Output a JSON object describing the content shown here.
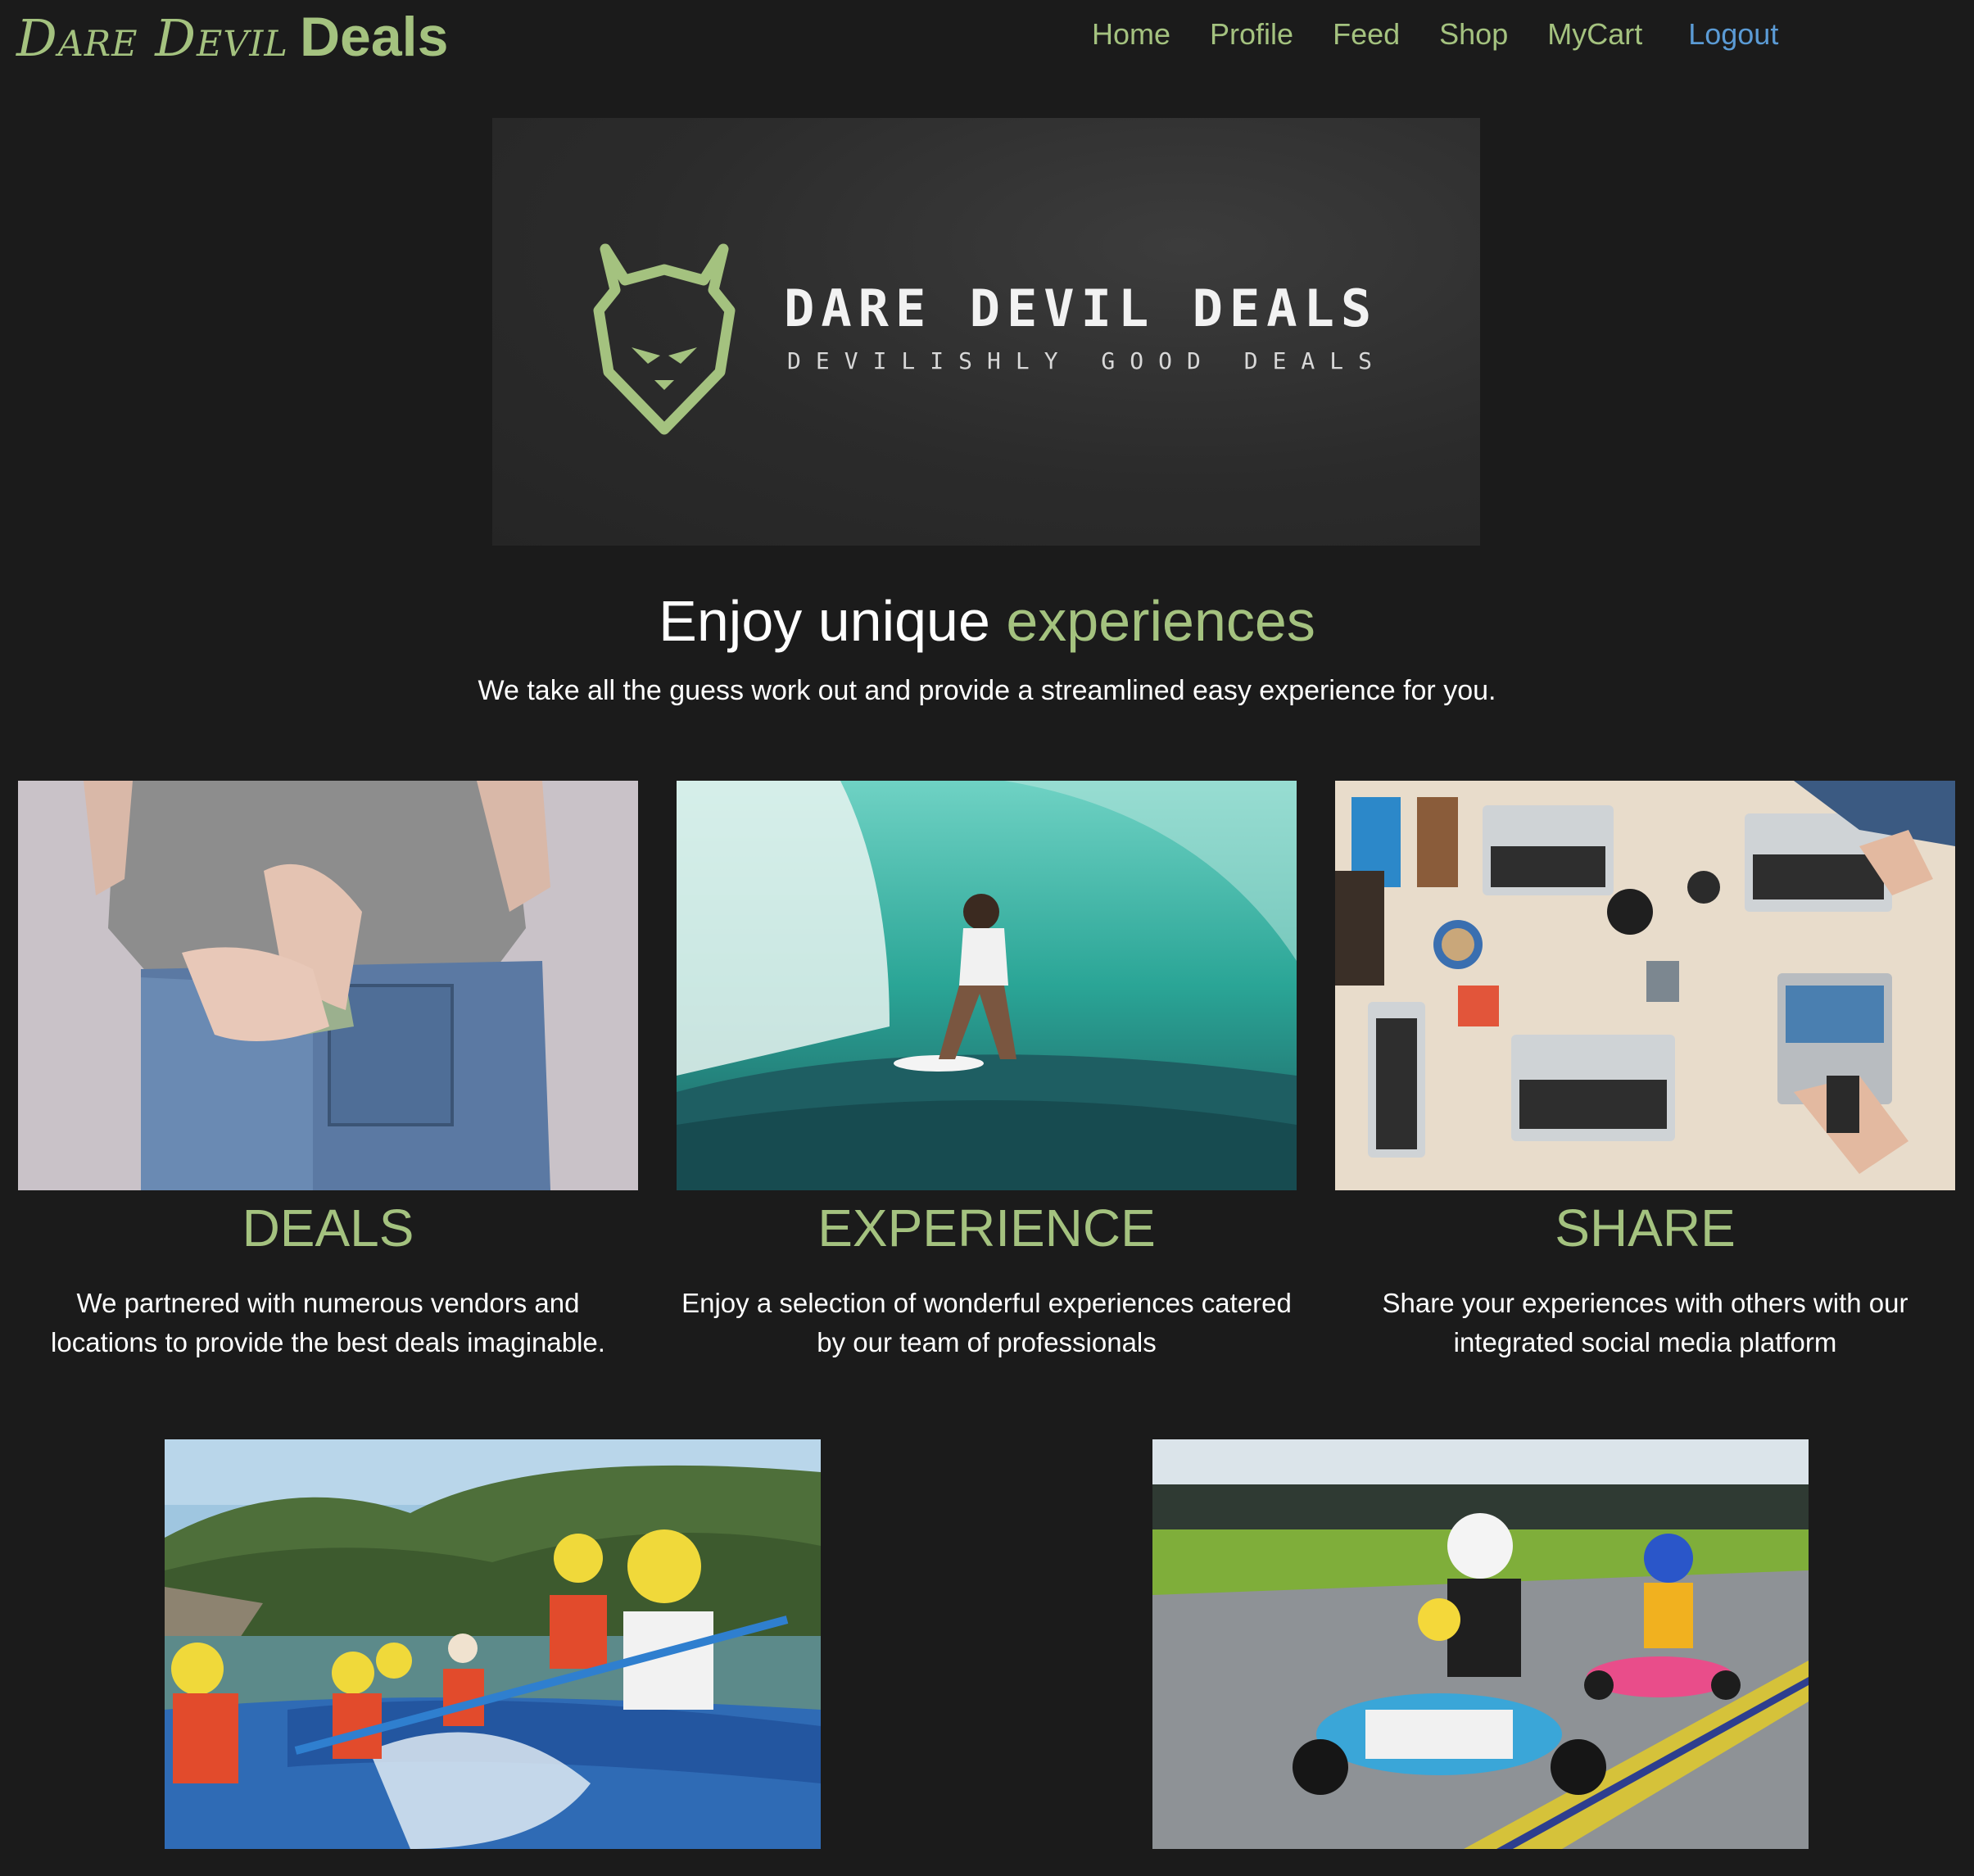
{
  "navbar": {
    "brand_script": "Dare Devil",
    "brand_bold": "Deals",
    "links": [
      {
        "label": "Home"
      },
      {
        "label": "Profile"
      },
      {
        "label": "Feed"
      },
      {
        "label": "Shop"
      },
      {
        "label": "MyCart"
      },
      {
        "label": "Logout"
      }
    ]
  },
  "hero": {
    "title": "DARE DEVIL DEALS",
    "subtitle": "DEVILISHLY GOOD DEALS"
  },
  "headline": {
    "prefix": "Enjoy unique",
    "accent": "experiences",
    "subtitle": "We take all the guess work out and provide a streamlined easy experience for you."
  },
  "features": [
    {
      "title": "DEALS",
      "text": "We partnered with numerous vendors and locations to provide the best deals imaginable."
    },
    {
      "title": "EXPERIENCE",
      "text": "Enjoy a selection of wonderful experiences catered by our team of professionals"
    },
    {
      "title": "SHARE",
      "text": "Share your experiences with others with our integrated social media platform"
    }
  ],
  "colors": {
    "background": "#1b1b1b",
    "accent_green": "#a4c27f",
    "logout_blue": "#5b9bd5",
    "text": "#ffffff"
  }
}
